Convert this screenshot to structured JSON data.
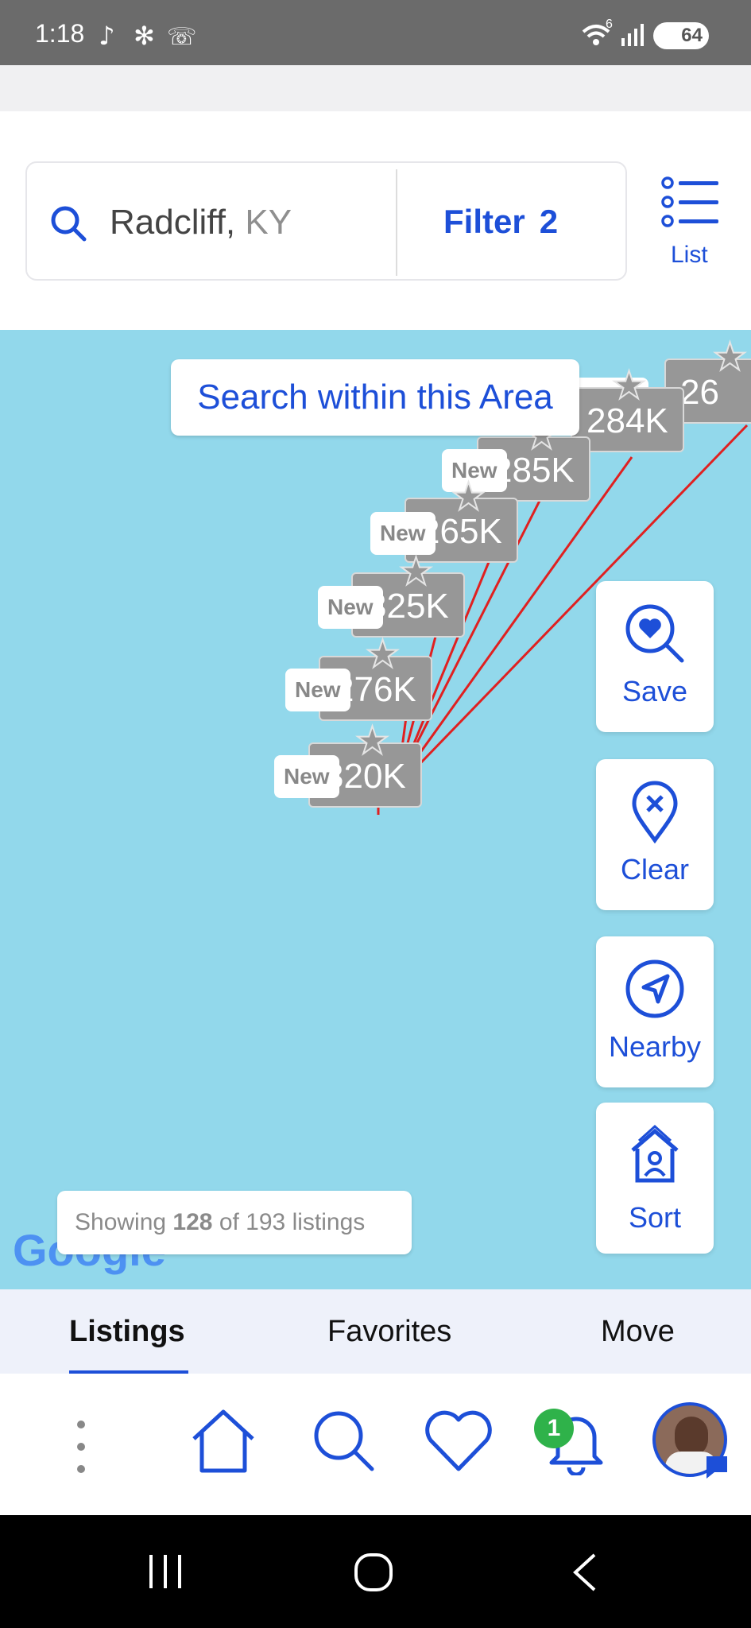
{
  "status_bar": {
    "time": "1:18",
    "battery": "64",
    "wifi_label": "6"
  },
  "search": {
    "location_city": "Radcliff,",
    "location_state": "KY",
    "filter_label": "Filter",
    "filter_count": "2",
    "list_label": "List"
  },
  "map": {
    "search_area_label": "Search within this Area",
    "markers": [
      {
        "price": "26",
        "new": ""
      },
      {
        "price": "284K",
        "new": ""
      },
      {
        "price": "285K",
        "new": "New"
      },
      {
        "price": "265K",
        "new": "New"
      },
      {
        "price": "325K",
        "new": "New"
      },
      {
        "price": "276K",
        "new": "New"
      },
      {
        "price": "320K",
        "new": "New"
      }
    ],
    "showing": {
      "prefix": "Showing",
      "shown": "128",
      "middle": "of 193 listings"
    },
    "google_logo": "Google"
  },
  "side_buttons": {
    "save": "Save",
    "clear": "Clear",
    "nearby": "Nearby",
    "sort": "Sort"
  },
  "tabs": [
    {
      "label": "Listings",
      "active": true
    },
    {
      "label": "Favorites"
    },
    {
      "label": "Move"
    }
  ],
  "bottom_nav": {
    "notification_count": "1"
  },
  "colors": {
    "accent": "#1d4fd8",
    "map": "#92d8eb",
    "marker": "#979797",
    "route": "#e02020",
    "badge": "#2fb24a"
  }
}
